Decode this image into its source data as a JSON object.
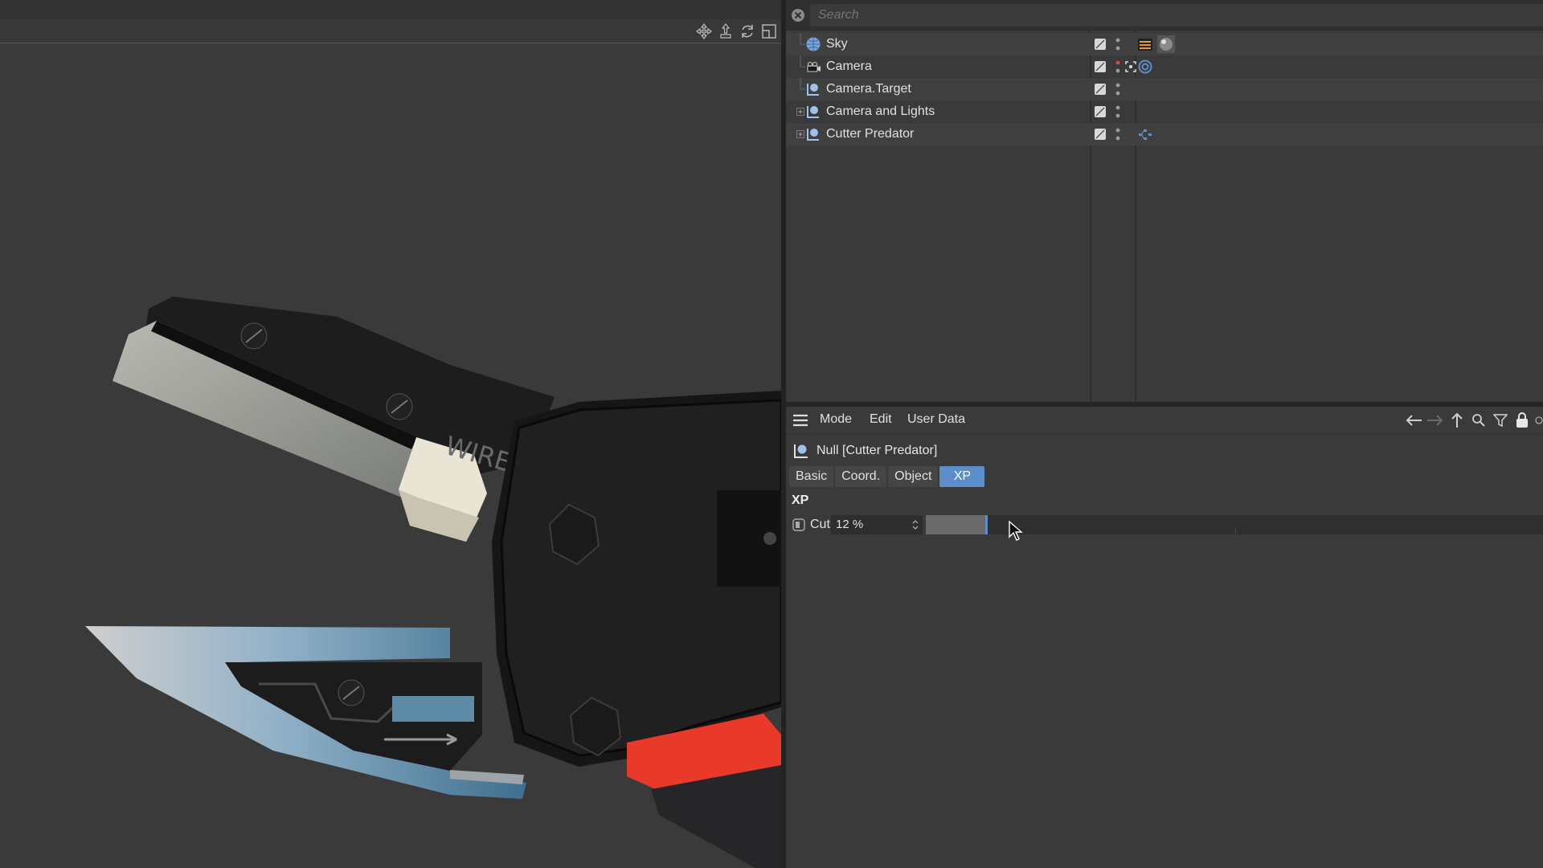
{
  "object_manager": {
    "search_placeholder": "Search",
    "objects": [
      {
        "name": "Sky",
        "icon": "sky-icon",
        "expandable": false,
        "tags": [
          "scene-tag-icon",
          "material-tag-icon"
        ]
      },
      {
        "name": "Camera",
        "icon": "camera-icon",
        "expandable": false,
        "tags": [
          "target-tag-icon"
        ]
      },
      {
        "name": "Camera.Target",
        "icon": "null-icon",
        "expandable": false,
        "tags": []
      },
      {
        "name": "Camera and Lights",
        "icon": "null-icon",
        "expandable": true,
        "tags": []
      },
      {
        "name": "Cutter Predator",
        "icon": "null-icon",
        "expandable": true,
        "tags": [
          "xpresso-tag-icon"
        ]
      }
    ]
  },
  "attribute_manager": {
    "menu": {
      "mode": "Mode",
      "edit": "Edit",
      "user_data": "User Data"
    },
    "object_title": "Null [Cutter Predator]",
    "tabs": [
      {
        "label": "Basic",
        "active": false
      },
      {
        "label": "Coord.",
        "active": false
      },
      {
        "label": "Object",
        "active": false
      },
      {
        "label": "XP",
        "active": true
      }
    ],
    "group_title": "XP",
    "parameter": {
      "label": "Cut",
      "value_text": "12 %",
      "value": 0.12
    }
  },
  "viewport": {
    "model_text": "WIRE",
    "accent_color": "#e8392b"
  },
  "colors": {
    "accent": "#5c8fc9",
    "panel_bg": "#3a3a3a"
  }
}
